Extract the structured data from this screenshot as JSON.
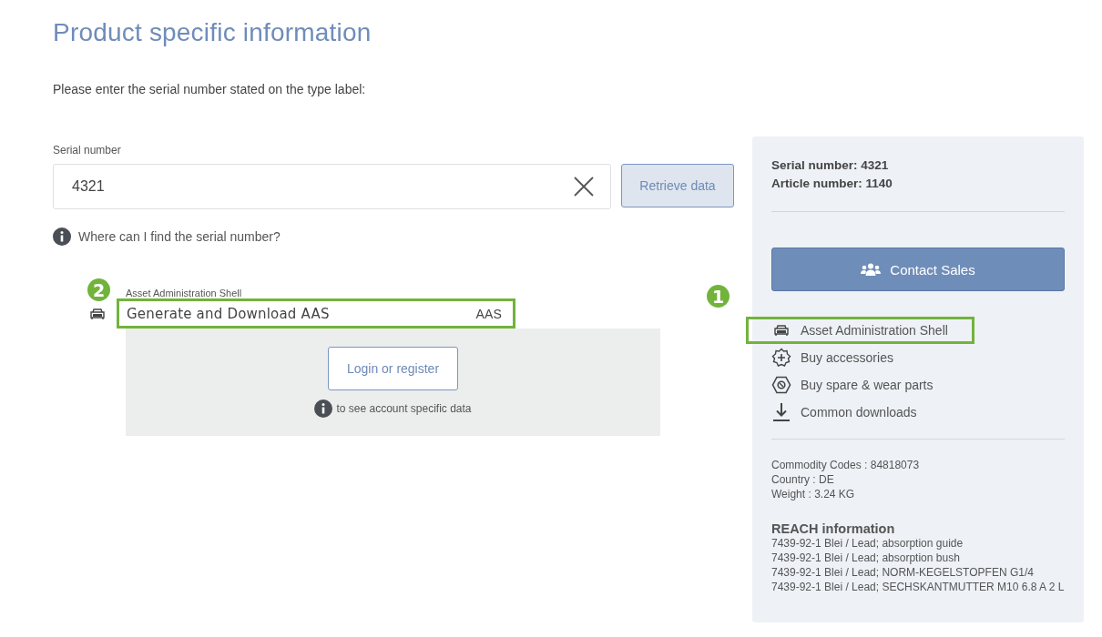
{
  "title": "Product specific information",
  "instruction": "Please enter the serial number stated on the type label:",
  "serial_field": {
    "label": "Serial number",
    "value": "4321"
  },
  "retrieve_button": {
    "label": "Retrieve data",
    "disabled": true
  },
  "help_link": "Where can I find the serial number?",
  "aas_section": {
    "label": "Asset Administration Shell",
    "value": "Generate and Download AAS",
    "suffix": "AAS",
    "highlighted": true,
    "callout": "2",
    "login_button": "Login or register",
    "login_hint": "to see account specific data"
  },
  "sidebar": {
    "serial_number": "Serial number: 4321",
    "article_number": "Article number: 1140",
    "contact_button": "Contact Sales",
    "links": [
      {
        "kind": "aas",
        "label": "Asset Administration Shell",
        "highlighted": true,
        "callout": "1"
      },
      {
        "kind": "accessories",
        "label": "Buy accessories",
        "highlighted": false
      },
      {
        "kind": "spare",
        "label": "Buy spare & wear parts",
        "highlighted": false
      },
      {
        "kind": "download",
        "label": "Common downloads",
        "highlighted": false
      }
    ],
    "details": [
      "Commodity Codes : 84818073",
      "Country : DE",
      "Weight : 3.24 KG"
    ],
    "reach_title": "REACH information",
    "reach_items": [
      "7439-92-1 Blei / Lead; absorption guide",
      "7439-92-1 Blei / Lead; absorption bush",
      "7439-92-1 Blei / Lead; NORM-KEGELSTOPFEN G1/4",
      "7439-92-1 Blei / Lead; SECHSKANTMUTTER M10 6.8 A 2 L"
    ]
  }
}
